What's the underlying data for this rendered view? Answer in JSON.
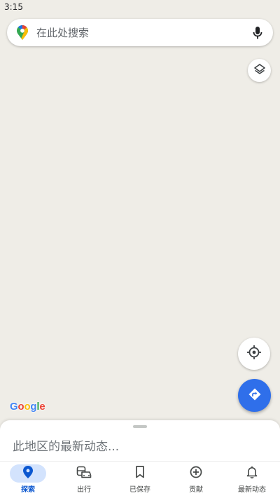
{
  "status_bar": {
    "time": "3:15"
  },
  "search": {
    "placeholder": "在此处搜索"
  },
  "map": {
    "logo": "Google",
    "background_color": "#efede7"
  },
  "controls": {
    "layers_icon": "layers-icon",
    "locate_icon": "my-location-icon",
    "directions_icon": "directions-icon",
    "directions_color": "#2f6fea"
  },
  "sheet": {
    "title": "此地区的最新动态..."
  },
  "bottom_nav": {
    "accent": "#0b57d0",
    "items": [
      {
        "label": "探索",
        "icon": "explore-pin-icon",
        "active": true
      },
      {
        "label": "出行",
        "icon": "commute-icon",
        "active": false
      },
      {
        "label": "已保存",
        "icon": "bookmark-icon",
        "active": false
      },
      {
        "label": "贡献",
        "icon": "add-circle-icon",
        "active": false
      },
      {
        "label": "最新动态",
        "icon": "bell-icon",
        "active": false
      }
    ]
  }
}
